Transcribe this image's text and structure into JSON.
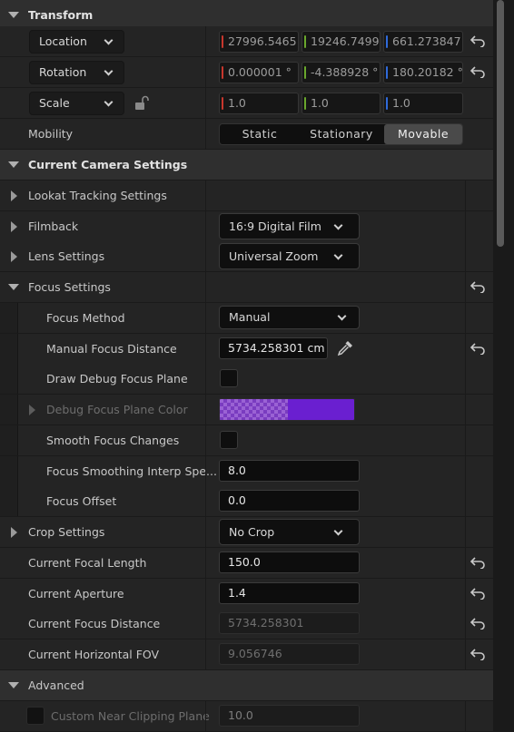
{
  "transform": {
    "title": "Transform",
    "location": {
      "label": "Location",
      "x": "27996.5465",
      "y": "19246.7499",
      "z": "661.273847"
    },
    "rotation": {
      "label": "Rotation",
      "x": "0.000001 °",
      "y": "-4.388928 °",
      "z": "180.20182 °"
    },
    "scale": {
      "label": "Scale",
      "x": "1.0",
      "y": "1.0",
      "z": "1.0"
    },
    "mobility": {
      "label": "Mobility",
      "options": [
        "Static",
        "Stationary",
        "Movable"
      ],
      "selected": "Movable"
    }
  },
  "camera": {
    "title": "Current Camera Settings",
    "lookat": "Lookat Tracking Settings",
    "filmback": {
      "label": "Filmback",
      "value": "16:9 Digital Film"
    },
    "lens": {
      "label": "Lens Settings",
      "value": "Universal Zoom"
    },
    "focus": {
      "title": "Focus Settings",
      "method": {
        "label": "Focus Method",
        "value": "Manual"
      },
      "manual_distance": {
        "label": "Manual Focus Distance",
        "value": "5734.258301 cm"
      },
      "draw_debug": {
        "label": "Draw Debug Focus Plane"
      },
      "debug_color": {
        "label": "Debug Focus Plane Color",
        "color": "#6a1fd0"
      },
      "smooth": {
        "label": "Smooth Focus Changes"
      },
      "smoothing_speed": {
        "label": "Focus Smoothing Interp Spe...",
        "value": "8.0"
      },
      "offset": {
        "label": "Focus Offset",
        "value": "0.0"
      }
    },
    "crop": {
      "label": "Crop Settings",
      "value": "No Crop"
    },
    "focal_length": {
      "label": "Current Focal Length",
      "value": "150.0"
    },
    "aperture": {
      "label": "Current Aperture",
      "value": "1.4"
    },
    "focus_distance": {
      "label": "Current Focus Distance",
      "value": "5734.258301"
    },
    "hfov": {
      "label": "Current Horizontal FOV",
      "value": "9.056746"
    }
  },
  "advanced": {
    "title": "Advanced",
    "near_clip": {
      "label": "Custom Near Clipping Plane",
      "value": "10.0"
    }
  },
  "icons": {
    "reset": "reset-arrow-icon",
    "lock": "padlock-icon",
    "eyedropper": "eyedropper-icon"
  }
}
